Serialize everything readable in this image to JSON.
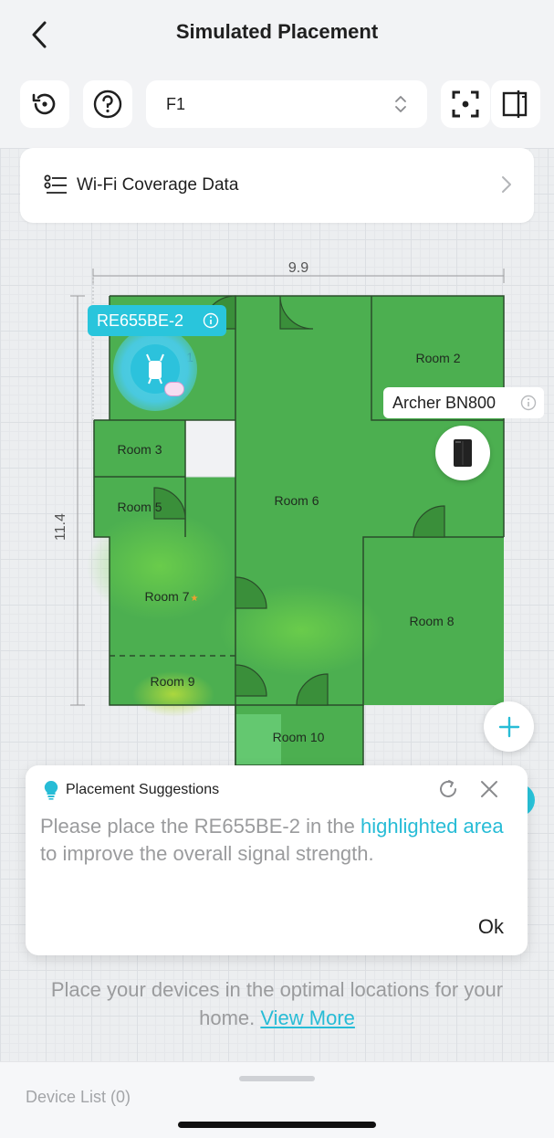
{
  "header": {
    "title": "Simulated Placement"
  },
  "toolbar": {
    "floor": "F1"
  },
  "coverage": {
    "label": "Wi-Fi Coverage Data"
  },
  "floorplan": {
    "width_label": "9.9",
    "height_label": "11.4",
    "rooms": {
      "room2": "Room 2",
      "room3": "Room 3",
      "room5": "Room 5",
      "room6": "Room 6",
      "room7": "Room 7",
      "room8": "Room 8",
      "room9": "Room 9",
      "room10": "Room 10"
    },
    "coverage_color": "#4caf50",
    "stray_digit": "1"
  },
  "devices": {
    "extender": {
      "name": "RE655BE-2",
      "color": "#29c5dc"
    },
    "router": {
      "name": "Archer BN800"
    }
  },
  "suggestion": {
    "title": "Placement Suggestions",
    "text_before": "Please place the RE655BE-2 in the ",
    "highlight": "highlighted area",
    "text_after": " to improve the overall signal strength.",
    "ok": "Ok"
  },
  "hint": {
    "text": "Place your devices in the optimal locations for your home. ",
    "link": "View More"
  },
  "bottom": {
    "device_list": "Device List (0)"
  }
}
